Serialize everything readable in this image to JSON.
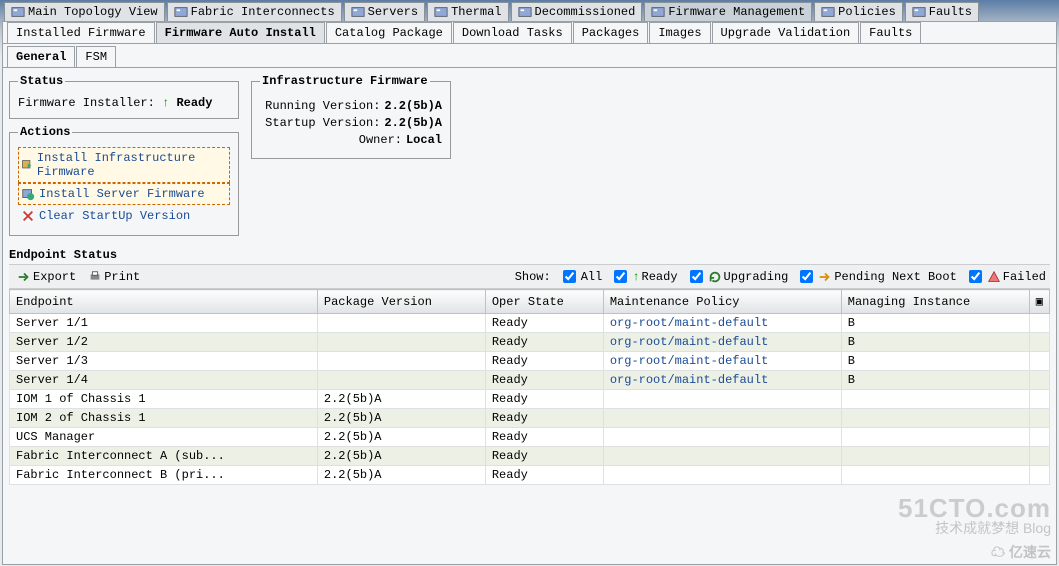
{
  "top_tabs": [
    {
      "label": "Main Topology View"
    },
    {
      "label": "Fabric Interconnects"
    },
    {
      "label": "Servers"
    },
    {
      "label": "Thermal"
    },
    {
      "label": "Decommissioned"
    },
    {
      "label": "Firmware Management",
      "active": true
    },
    {
      "label": "Policies"
    },
    {
      "label": "Faults"
    }
  ],
  "sub_tabs": [
    {
      "label": "Installed Firmware"
    },
    {
      "label": "Firmware Auto Install",
      "active": true
    },
    {
      "label": "Catalog Package"
    },
    {
      "label": "Download Tasks"
    },
    {
      "label": "Packages"
    },
    {
      "label": "Images"
    },
    {
      "label": "Upgrade Validation"
    },
    {
      "label": "Faults"
    }
  ],
  "inner_tabs": [
    {
      "label": "General",
      "active": true
    },
    {
      "label": "FSM"
    }
  ],
  "status": {
    "legend": "Status",
    "installer_label": "Firmware Installer:",
    "installer_value": "Ready"
  },
  "actions": {
    "legend": "Actions",
    "install_infra": "Install Infrastructure Firmware",
    "install_server": "Install Server Firmware",
    "clear_startup": "Clear StartUp Version"
  },
  "infra": {
    "legend": "Infrastructure Firmware",
    "running_label": "Running Version:",
    "running_value": "2.2(5b)A",
    "startup_label": "Startup Version:",
    "startup_value": "2.2(5b)A",
    "owner_label": "Owner:",
    "owner_value": "Local"
  },
  "endpoint": {
    "title": "Endpoint Status",
    "export": "Export",
    "print": "Print",
    "show_label": "Show:",
    "filters": {
      "all": "All",
      "ready": "Ready",
      "upgrading": "Upgrading",
      "pending": "Pending Next Boot",
      "failed": "Failed"
    },
    "columns": [
      "Endpoint",
      "Package Version",
      "Oper State",
      "Maintenance Policy",
      "Managing Instance"
    ],
    "rows": [
      {
        "endpoint": "Server 1/1",
        "pkg": "",
        "state": "Ready",
        "policy": "org-root/maint-default",
        "mi": "B",
        "alt": false
      },
      {
        "endpoint": "Server 1/2",
        "pkg": "",
        "state": "Ready",
        "policy": "org-root/maint-default",
        "mi": "B",
        "alt": true
      },
      {
        "endpoint": "Server 1/3",
        "pkg": "",
        "state": "Ready",
        "policy": "org-root/maint-default",
        "mi": "B",
        "alt": false
      },
      {
        "endpoint": "Server 1/4",
        "pkg": "",
        "state": "Ready",
        "policy": "org-root/maint-default",
        "mi": "B",
        "alt": true
      },
      {
        "endpoint": "IOM 1 of Chassis 1",
        "pkg": "2.2(5b)A",
        "state": "Ready",
        "policy": "",
        "mi": "",
        "alt": false
      },
      {
        "endpoint": "IOM 2 of Chassis 1",
        "pkg": "2.2(5b)A",
        "state": "Ready",
        "policy": "",
        "mi": "",
        "alt": true
      },
      {
        "endpoint": "UCS Manager",
        "pkg": "2.2(5b)A",
        "state": "Ready",
        "policy": "",
        "mi": "",
        "alt": false
      },
      {
        "endpoint": "Fabric Interconnect A (sub...",
        "pkg": "2.2(5b)A",
        "state": "Ready",
        "policy": "",
        "mi": "",
        "alt": true
      },
      {
        "endpoint": "Fabric Interconnect B (pri...",
        "pkg": "2.2(5b)A",
        "state": "Ready",
        "policy": "",
        "mi": "",
        "alt": false
      }
    ]
  },
  "watermarks": {
    "w1": "51CTO.com",
    "w1s": "技术成就梦想   Blog",
    "w2": "亿速云"
  }
}
